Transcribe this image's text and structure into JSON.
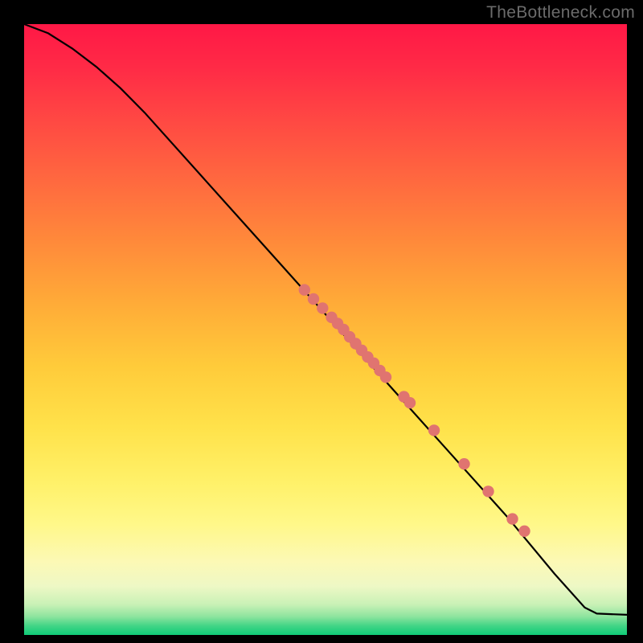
{
  "attribution": "TheBottleneck.com",
  "chart_data": {
    "type": "line",
    "title": "",
    "xlabel": "",
    "ylabel": "",
    "xlim": [
      0,
      100
    ],
    "ylim": [
      0,
      100
    ],
    "grid": false,
    "legend": false,
    "series": [
      {
        "name": "curve",
        "x": [
          0,
          4,
          8,
          12,
          16,
          20,
          30,
          40,
          50,
          60,
          70,
          80,
          88,
          93,
          95,
          100
        ],
        "y": [
          100,
          98.5,
          96,
          93,
          89.5,
          85.5,
          74.5,
          63.5,
          52.5,
          41.5,
          30.5,
          19.5,
          10,
          4.5,
          3.5,
          3.3
        ]
      },
      {
        "name": "points",
        "x": [
          46.5,
          48,
          49.5,
          51,
          52,
          53,
          54,
          55,
          56,
          57,
          58,
          59,
          60,
          63,
          64,
          68,
          73,
          77,
          81,
          83
        ],
        "y": [
          56.5,
          55,
          53.5,
          52,
          51,
          50,
          48.8,
          47.7,
          46.6,
          45.5,
          44.5,
          43.3,
          42.2,
          39,
          38,
          33.5,
          28,
          23.5,
          19,
          17
        ]
      }
    ]
  }
}
